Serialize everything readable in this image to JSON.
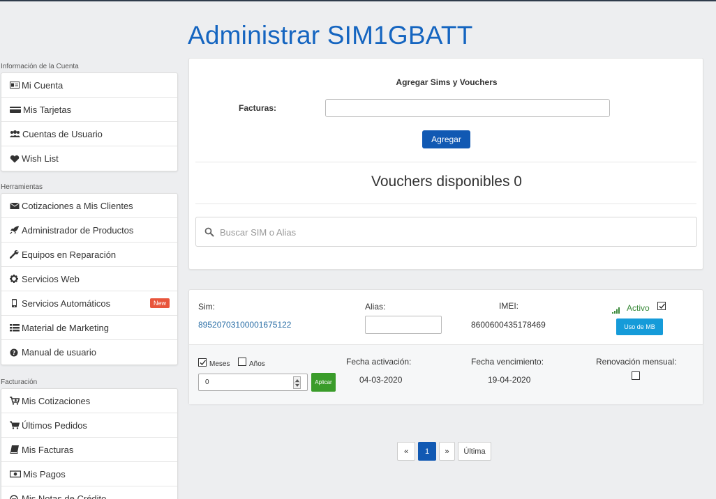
{
  "page": {
    "title": "Administrar SIM1GBATT"
  },
  "sidebar": {
    "sections": [
      {
        "title": "Información de la Cuenta",
        "items": [
          {
            "label": "Mi Cuenta",
            "icon": "id-card-icon"
          },
          {
            "label": "Mis Tarjetas",
            "icon": "credit-card-icon"
          },
          {
            "label": "Cuentas de Usuario",
            "icon": "users-icon"
          },
          {
            "label": "Wish List",
            "icon": "heart-icon"
          }
        ]
      },
      {
        "title": "Herramientas",
        "items": [
          {
            "label": "Cotizaciones a Mis Clientes",
            "icon": "envelope-icon"
          },
          {
            "label": "Administrador de Productos",
            "icon": "rocket-icon"
          },
          {
            "label": "Equipos en Reparación",
            "icon": "wrench-icon"
          },
          {
            "label": "Servicios Web",
            "icon": "gear-icon"
          },
          {
            "label": "Servicios Automáticos",
            "icon": "phone-icon",
            "badge": "New"
          },
          {
            "label": "Material de Marketing",
            "icon": "list-icon"
          },
          {
            "label": "Manual de usuario",
            "icon": "question-icon"
          }
        ]
      },
      {
        "title": "Facturación",
        "items": [
          {
            "label": "Mis Cotizaciones",
            "icon": "cart-plus-icon"
          },
          {
            "label": "Últimos Pedidos",
            "icon": "cart-icon"
          },
          {
            "label": "Mis Facturas",
            "icon": "book-icon"
          },
          {
            "label": "Mis Pagos",
            "icon": "money-icon"
          },
          {
            "label": "Mis Notas de Crédito",
            "icon": "credit-note-icon"
          }
        ]
      }
    ]
  },
  "add_panel": {
    "heading": "Agregar Sims y Vouchers",
    "facturas_label": "Facturas:",
    "facturas_value": "",
    "add_button": "Agregar",
    "vouchers_text": "Vouchers disponibles 0",
    "search_placeholder": "Buscar SIM o Alias"
  },
  "sim_card": {
    "sim_label": "Sim:",
    "sim_value": "89520703100001675122",
    "alias_label": "Alias:",
    "alias_value": "",
    "imei_label": "IMEI:",
    "imei_value": "8600600435178469",
    "status": "Activo",
    "status_checked": true,
    "uso_button": "Uso de MB",
    "meses_label": "Meses",
    "meses_checked": true,
    "anos_label": "Años",
    "anos_checked": false,
    "stepper_value": "0",
    "apply_button": "Aplicar",
    "activation_label": "Fecha activación:",
    "activation_value": "04-03-2020",
    "expiry_label": "Fecha vencimiento:",
    "expiry_value": "19-04-2020",
    "renewal_label": "Renovación mensual:",
    "renewal_checked": false
  },
  "pagination": {
    "prev": "«",
    "current": "1",
    "next": "»",
    "last": "Última"
  },
  "colors": {
    "primary": "#1159b3",
    "title": "#1565c0",
    "link": "#2a6ea6",
    "active_status": "#3a8a3a",
    "info_button": "#159bd9",
    "success_button": "#3a9c2a",
    "badge": "#e8553c"
  }
}
